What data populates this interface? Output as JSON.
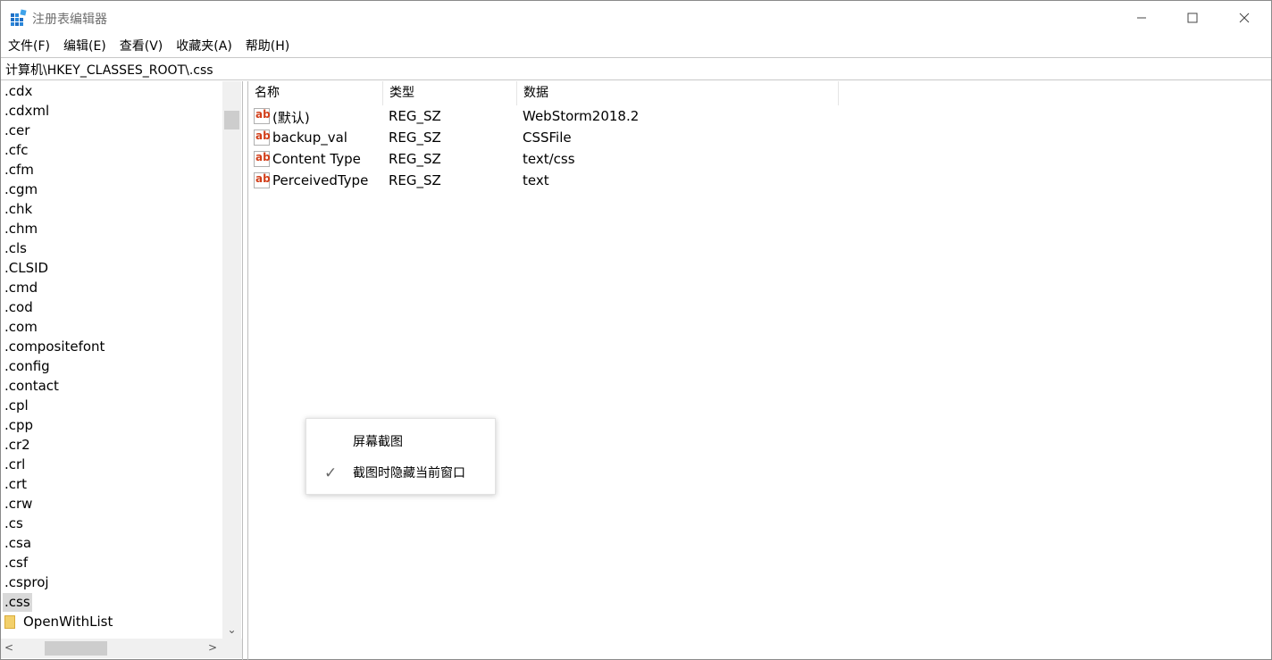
{
  "window": {
    "title": "注册表编辑器",
    "controls": {
      "minimize": "─",
      "maximize": "☐",
      "close": "✕"
    }
  },
  "menu": [
    "文件(F)",
    "编辑(E)",
    "查看(V)",
    "收藏夹(A)",
    "帮助(H)"
  ],
  "address": "计算机\\HKEY_CLASSES_ROOT\\.css",
  "tree": {
    "items": [
      ".cdx",
      ".cdxml",
      ".cer",
      ".cfc",
      ".cfm",
      ".cgm",
      ".chk",
      ".chm",
      ".cls",
      ".CLSID",
      ".cmd",
      ".cod",
      ".com",
      ".compositefont",
      ".config",
      ".contact",
      ".cpl",
      ".cpp",
      ".cr2",
      ".crl",
      ".crt",
      ".crw",
      ".cs",
      ".csa",
      ".csf",
      ".csproj",
      ".css"
    ],
    "selected": ".css",
    "children": [
      "OpenWithList"
    ],
    "scroll": {
      "up": "",
      "down": "⌄",
      "left": "<",
      "right": ">"
    }
  },
  "values": {
    "headers": {
      "name": "名称",
      "type": "类型",
      "data": "数据"
    },
    "icon_text": "ab",
    "rows": [
      {
        "name": "(默认)",
        "type": "REG_SZ",
        "data": "WebStorm2018.2"
      },
      {
        "name": "backup_val",
        "type": "REG_SZ",
        "data": "CSSFile"
      },
      {
        "name": "Content Type",
        "type": "REG_SZ",
        "data": "text/css"
      },
      {
        "name": "PerceivedType",
        "type": "REG_SZ",
        "data": "text"
      }
    ]
  },
  "context_menu": {
    "items": [
      {
        "label": "屏幕截图",
        "checked": false
      },
      {
        "label": "截图时隐藏当前窗口",
        "checked": true
      }
    ],
    "check_glyph": "✓"
  },
  "colors": {
    "icon_red": "#d23f1a",
    "selection": "#d9d9d9",
    "folder": "#f3d06b"
  }
}
